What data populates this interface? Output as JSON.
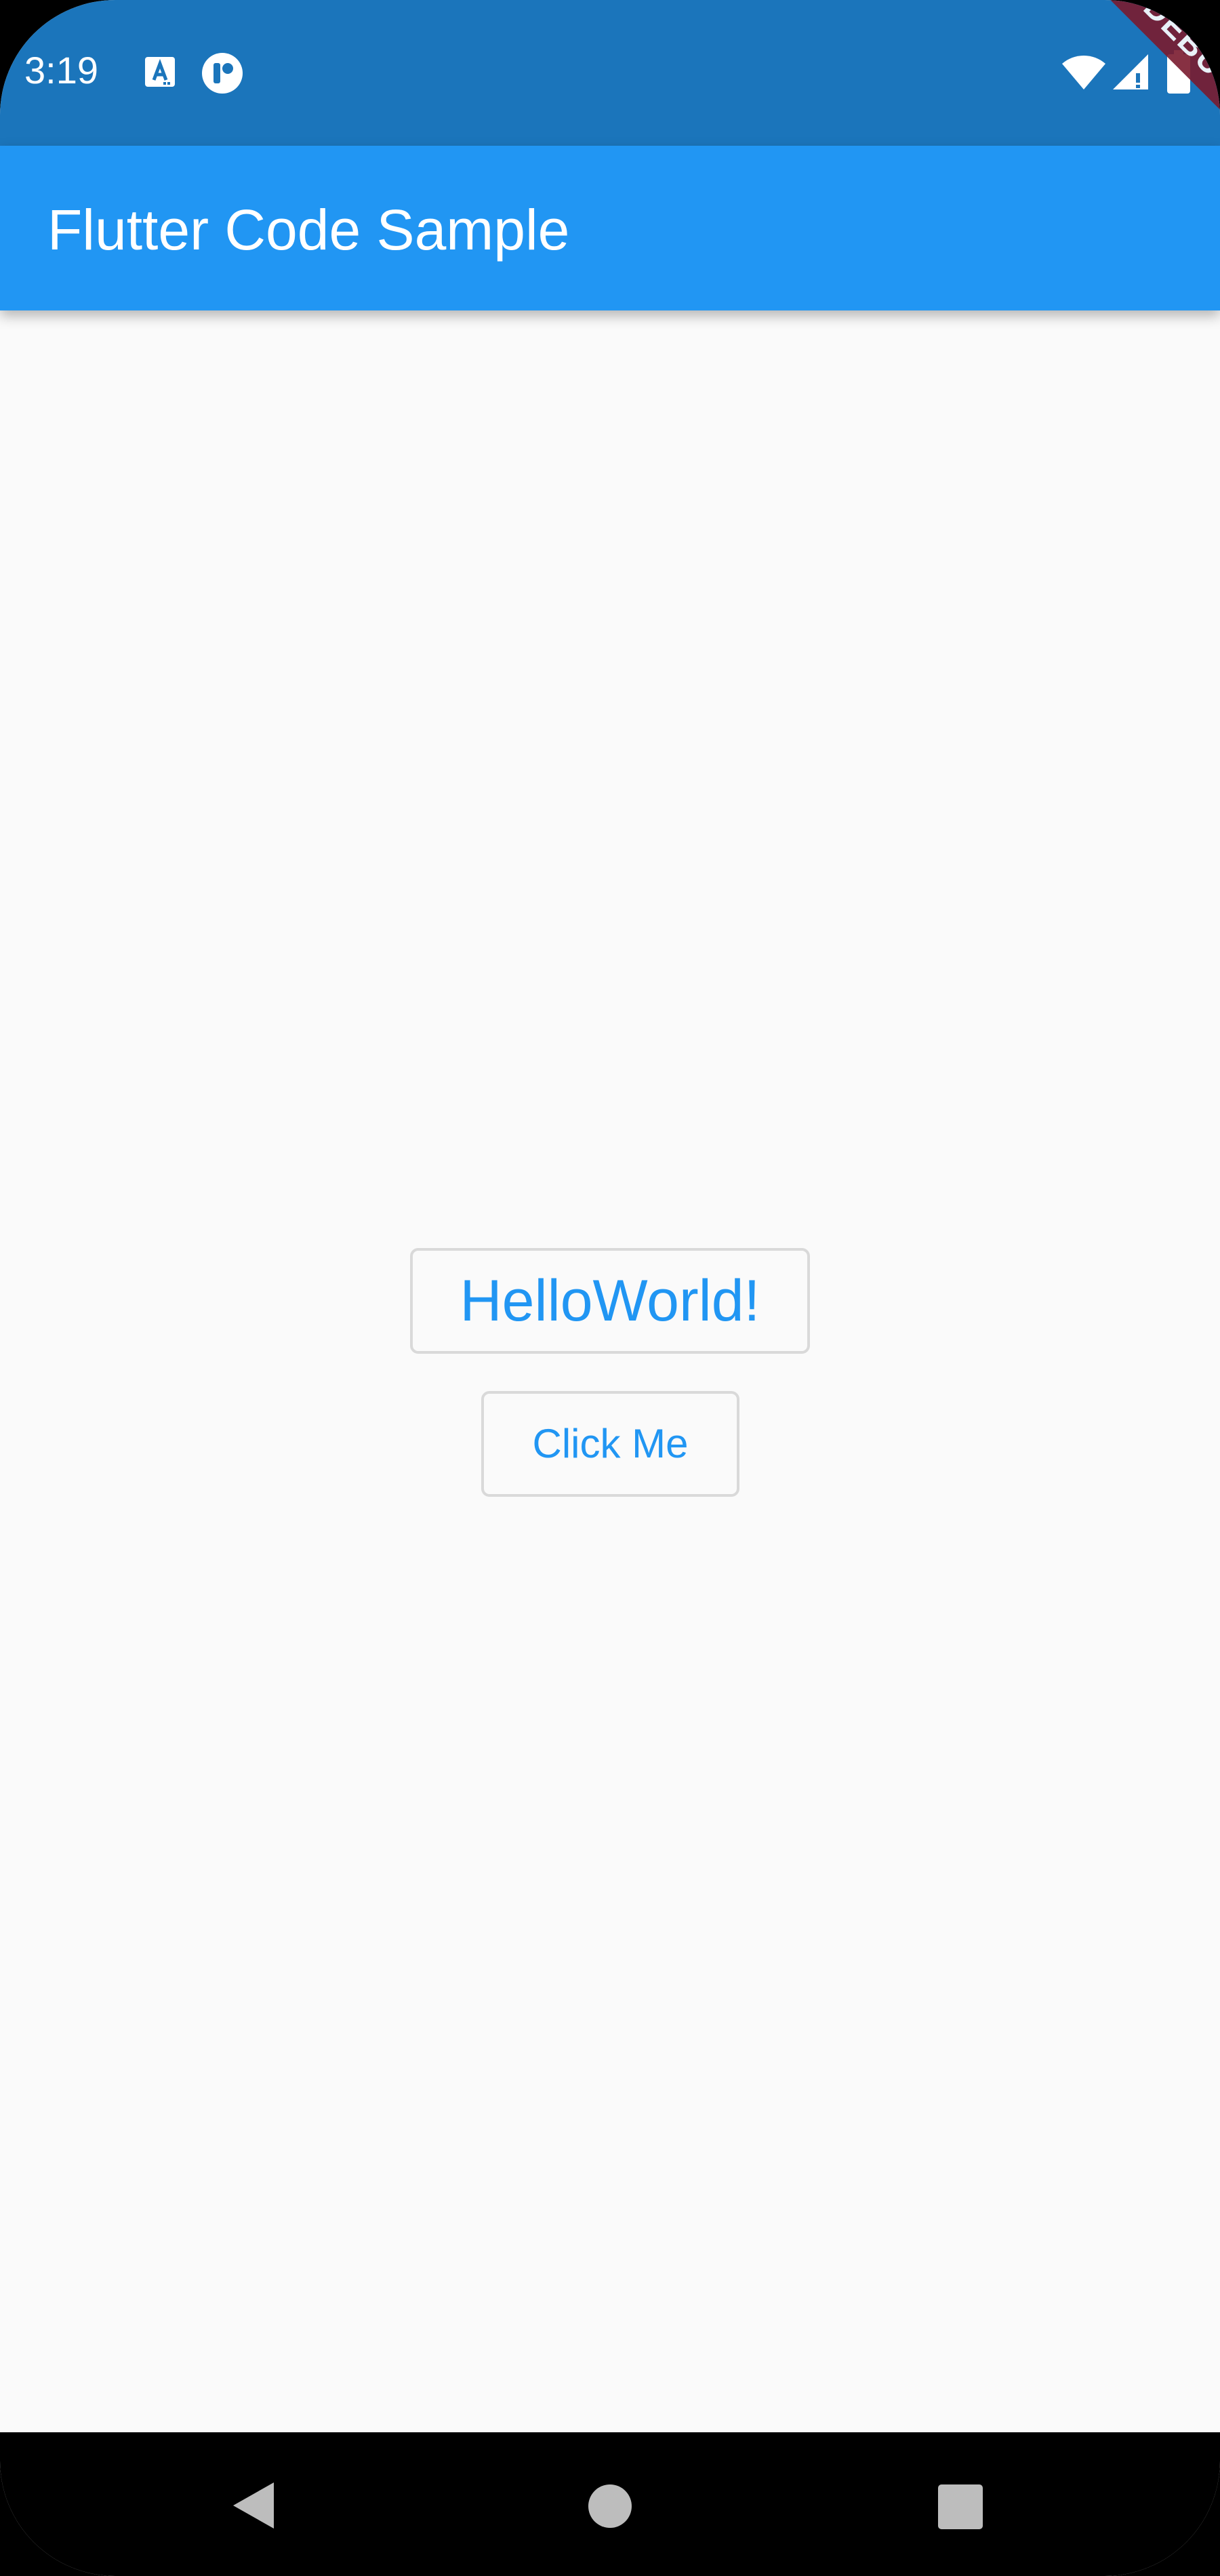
{
  "status_bar": {
    "time": "3:19",
    "icons": [
      "a-icon",
      "app-notification-icon",
      "wifi-icon",
      "signal-icon",
      "battery-icon"
    ],
    "background_color": "#1b75bb"
  },
  "app_bar": {
    "title": "Flutter Code Sample",
    "background_color": "#2196f3"
  },
  "debug_banner": {
    "label": "DEBUG"
  },
  "main": {
    "hello_button_label": "HelloWorld!",
    "click_button_label": "Click Me",
    "accent_color": "#2196f3"
  },
  "nav_bar": {
    "buttons": [
      "back-icon",
      "home-icon",
      "recents-icon"
    ]
  }
}
